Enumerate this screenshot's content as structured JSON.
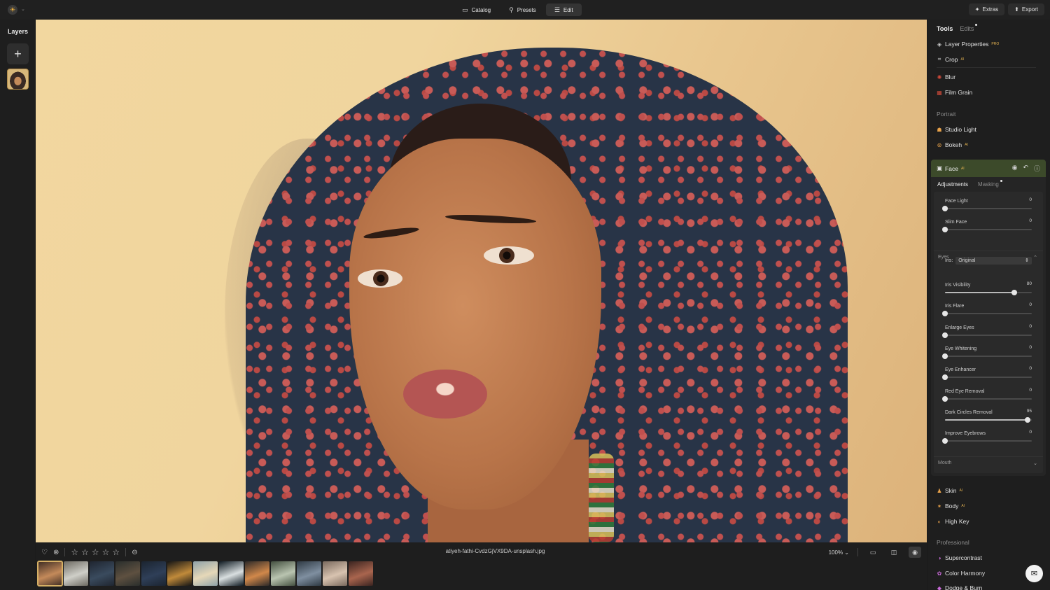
{
  "topbar": {
    "nav": [
      {
        "label": "Catalog",
        "icon": "folder-icon",
        "active": false
      },
      {
        "label": "Presets",
        "icon": "wand-icon",
        "active": false
      },
      {
        "label": "Edit",
        "icon": "sliders-icon",
        "active": true
      }
    ],
    "extras_label": "Extras",
    "export_label": "Export"
  },
  "layers": {
    "title": "Layers"
  },
  "bottombar": {
    "filename": "atiyeh-fathi-CvdzGjVX9DA-unsplash.jpg",
    "zoom": "100%",
    "rating": 0,
    "thumbnails": [
      {
        "colors": [
          "#3b2a22",
          "#c48a5a"
        ]
      },
      {
        "colors": [
          "#6d6a62",
          "#cfcfc8"
        ]
      },
      {
        "colors": [
          "#1f2530",
          "#3a4b5e"
        ]
      },
      {
        "colors": [
          "#2a2e2c",
          "#5e5040"
        ]
      },
      {
        "colors": [
          "#1b2430",
          "#2f3f58"
        ]
      },
      {
        "colors": [
          "#151515",
          "#c08a3a"
        ]
      },
      {
        "colors": [
          "#8fa2a8",
          "#e6d8b8"
        ]
      },
      {
        "colors": [
          "#0f1a22",
          "#d9dfe0"
        ]
      },
      {
        "colors": [
          "#2e2a28",
          "#d1884a"
        ]
      },
      {
        "colors": [
          "#445040",
          "#b9c4b0"
        ]
      },
      {
        "colors": [
          "#2f3a44",
          "#7f8fa0"
        ]
      },
      {
        "colors": [
          "#7a6a5e",
          "#d8c3b0"
        ]
      },
      {
        "colors": [
          "#3a2420",
          "#a9654e"
        ]
      }
    ]
  },
  "panel": {
    "tabs": {
      "tools": "Tools",
      "edits": "Edits"
    },
    "tools_top": [
      {
        "label": "Layer Properties",
        "badge": "PRO",
        "icon": "layers-icon",
        "color": "#cfcfcf"
      },
      {
        "label": "Crop",
        "badge": "AI",
        "icon": "crop-icon",
        "color": "#cfcfcf"
      },
      {
        "label": "Blur",
        "badge": "",
        "icon": "blur-icon",
        "color": "#d04a3a"
      },
      {
        "label": "Film Grain",
        "badge": "",
        "icon": "film-grain-icon",
        "color": "#d04a3a"
      }
    ],
    "portrait_title": "Portrait",
    "portrait_tools": [
      {
        "label": "Studio Light",
        "badge": "",
        "icon": "studio-light-icon",
        "color": "#e8a24a"
      },
      {
        "label": "Bokeh",
        "badge": "AI",
        "icon": "bokeh-icon",
        "color": "#e8a24a"
      }
    ],
    "face": {
      "title": "Face",
      "badge": "AI",
      "subtabs": {
        "adjustments": "Adjustments",
        "masking": "Masking"
      },
      "sliders_top": [
        {
          "label": "Face Light",
          "value": 0,
          "fraction": 0
        },
        {
          "label": "Slim Face",
          "value": 0,
          "fraction": 0
        }
      ],
      "eyes_title": "Eyes",
      "iris_label": "Iris:",
      "iris_value": "Original",
      "eye_sliders": [
        {
          "label": "Iris Visibility",
          "value": 80,
          "fraction": 0.8
        },
        {
          "label": "Iris Flare",
          "value": 0,
          "fraction": 0
        },
        {
          "label": "Enlarge Eyes",
          "value": 0,
          "fraction": 0
        },
        {
          "label": "Eye Whitening",
          "value": 0,
          "fraction": 0
        },
        {
          "label": "Eye Enhancer",
          "value": 0,
          "fraction": 0
        },
        {
          "label": "Red Eye Removal",
          "value": 0,
          "fraction": 0
        },
        {
          "label": "Dark Circles Removal",
          "value": 95,
          "fraction": 0.95
        },
        {
          "label": "Improve Eyebrows",
          "value": 0,
          "fraction": 0
        }
      ],
      "mouth_title": "Mouth"
    },
    "tools_bottom": [
      {
        "label": "Skin",
        "badge": "AI",
        "icon": "skin-icon",
        "color": "#e8a24a"
      },
      {
        "label": "Body",
        "badge": "AI",
        "icon": "body-icon",
        "color": "#e8a24a"
      },
      {
        "label": "High Key",
        "badge": "",
        "icon": "high-key-icon",
        "color": "#e8a24a"
      }
    ],
    "professional_title": "Professional",
    "professional_tools": [
      {
        "label": "Supercontrast",
        "badge": "",
        "icon": "supercontrast-icon",
        "color": "#c86ad8"
      },
      {
        "label": "Color Harmony",
        "badge": "",
        "icon": "color-harmony-icon",
        "color": "#c86ad8"
      },
      {
        "label": "Dodge & Burn",
        "badge": "",
        "icon": "dodge-burn-icon",
        "color": "#c86ad8"
      }
    ]
  }
}
